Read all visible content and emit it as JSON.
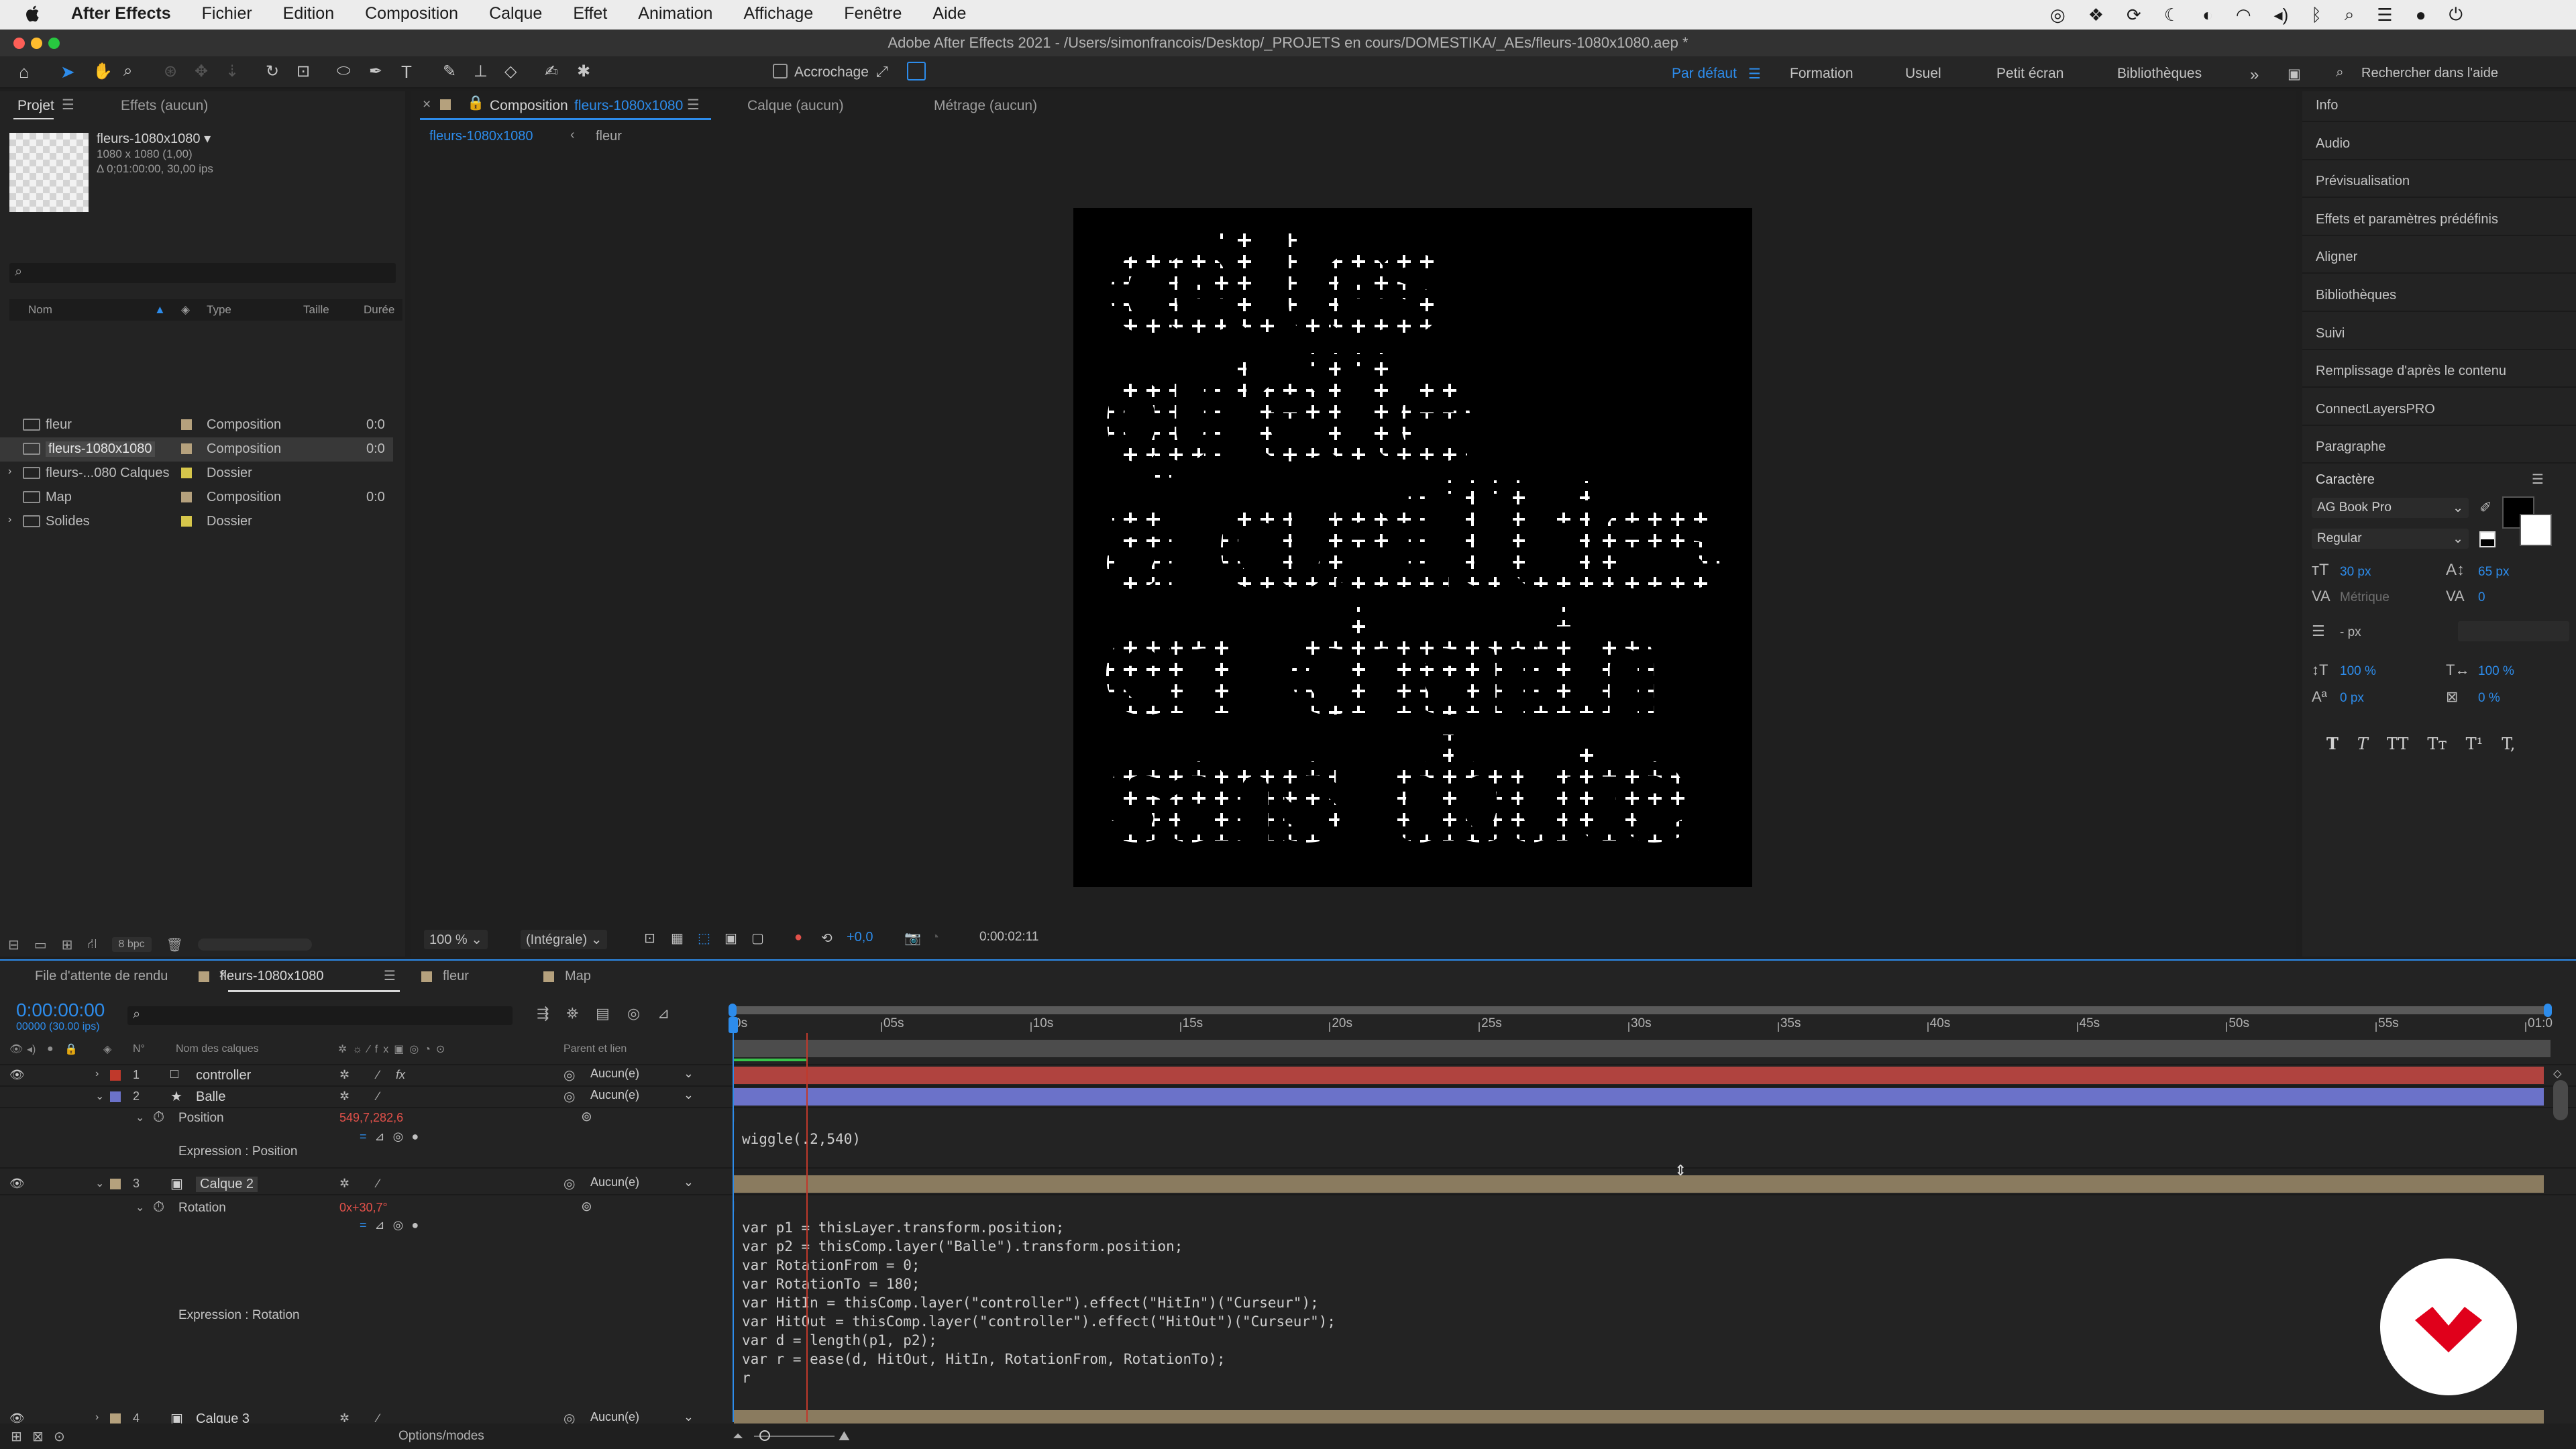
{
  "menubar": {
    "app": "After Effects",
    "items": [
      "Fichier",
      "Edition",
      "Composition",
      "Calque",
      "Effet",
      "Animation",
      "Affichage",
      "Fenêtre",
      "Aide"
    ]
  },
  "window_title": "Adobe After Effects 2021 - /Users/simonfrancois/Desktop/_PROJETS en cours/DOMESTIKA/_AEs/fleurs-1080x1080.aep *",
  "toolbar": {
    "snapping_label": "Accrochage",
    "workspaces": [
      "Par défaut",
      "Formation",
      "Usuel",
      "Petit écran",
      "Bibliothèques"
    ],
    "search_placeholder": "Rechercher dans l'aide"
  },
  "project": {
    "tab": "Projet",
    "effects_tab": "Effets (aucun)",
    "comp_name": "fleurs-1080x1080 ▾",
    "comp_size": "1080 x 1080 (1,00)",
    "comp_duration": "Δ 0;01:00:00, 30,00 ips",
    "search_placeholder": "",
    "columns": {
      "name": "Nom",
      "type": "Type",
      "size": "Taille",
      "duration": "Durée"
    },
    "items": [
      {
        "name": "fleur",
        "type": "Composition",
        "color": "#b5a17d",
        "dur": "0:0"
      },
      {
        "name": "fleurs-1080x1080",
        "type": "Composition",
        "color": "#b5a17d",
        "dur": "0:0",
        "selected": true
      },
      {
        "name": "fleurs-...080 Calques",
        "type": "Dossier",
        "color": "#d6c64b",
        "dur": ""
      },
      {
        "name": "Map",
        "type": "Composition",
        "color": "#b5a17d",
        "dur": "0:0"
      },
      {
        "name": "Solides",
        "type": "Dossier",
        "color": "#d6c64b",
        "dur": ""
      }
    ],
    "bpc": "8 bpc"
  },
  "viewer": {
    "tab_prefix": "Composition",
    "tab_name": "fleurs-1080x1080",
    "layer_tab": "Calque (aucun)",
    "footage_tab": "Métrage (aucun)",
    "crumb1": "fleurs-1080x1080",
    "crumb2": "fleur",
    "zoom": "100 %",
    "resolution": "(Intégrale)",
    "exposure": "+0,0",
    "timecode": "0:00:02:11",
    "lines": [
      "celles",
      "qu'elle",
      "a cueillies",
      "en chemin",
      "sans doute"
    ]
  },
  "right_panels": [
    "Info",
    "Audio",
    "Prévisualisation",
    "Effets et paramètres prédéfinis",
    "Aligner",
    "Bibliothèques",
    "Suivi",
    "Remplissage d'après le contenu",
    "ConnectLayersPRO",
    "Paragraphe"
  ],
  "character": {
    "title": "Caractère",
    "font": "AG Book Pro",
    "style": "Regular",
    "size": "30 px",
    "leading": "65 px",
    "kerning": "Métrique",
    "tracking": "0",
    "stroke": "- px",
    "vscale": "100 %",
    "hscale": "100 %",
    "baseline": "0 px",
    "tsume": "0 %",
    "styles": [
      "T",
      "T",
      "TT",
      "Tт",
      "T¹",
      "T,"
    ]
  },
  "timeline": {
    "tabs": [
      "File d'attente de rendu",
      "fleurs-1080x1080",
      "fleur",
      "Map"
    ],
    "timecode": "0:00:00:00",
    "fps": "00000 (30.00 ips)",
    "col_num": "N°",
    "col_name": "Nom des calques",
    "col_parent": "Parent et lien",
    "ruler": [
      "0s",
      "05s",
      "10s",
      "15s",
      "20s",
      "25s",
      "30s",
      "35s",
      "40s",
      "45s",
      "50s",
      "55s",
      "01:0"
    ],
    "layers": [
      {
        "num": "1",
        "name": "controller",
        "parent": "Aucun(e)",
        "color": "#c0392b"
      },
      {
        "num": "2",
        "name": "Balle",
        "parent": "Aucun(e)",
        "color": "#6b72c9"
      },
      {
        "num": "3",
        "name": "Calque 2",
        "parent": "Aucun(e)",
        "color": "#b5a17d"
      },
      {
        "num": "4",
        "name": "Calque 3",
        "parent": "Aucun(e)",
        "color": "#b5a17d"
      }
    ],
    "pos_label": "Position",
    "pos_value": "549,7,282,6",
    "expr_pos_label": "Expression : Position",
    "expr_pos": "wiggle(.2,540)",
    "rot_label": "Rotation",
    "rot_value": "0x+30,7°",
    "expr_rot_label": "Expression : Rotation",
    "expr_rot": [
      "var p1 = thisLayer.transform.position;",
      "var p2 = thisComp.layer(\"Balle\").transform.position;",
      "var RotationFrom = 0;",
      "var RotationTo = 180;",
      "var HitIn = thisComp.layer(\"controller\").effect(\"HitIn\")(\"Curseur\");",
      "var HitOut = thisComp.layer(\"controller\").effect(\"HitOut\")(\"Curseur\");",
      "var d = length(p1, p2);",
      "var r = ease(d, HitOut, HitIn, RotationFrom, RotationTo);",
      "r"
    ],
    "options": "Options/modes"
  },
  "colors": {
    "accent": "#2d8ceb",
    "brand_logo": "#e0001b"
  }
}
